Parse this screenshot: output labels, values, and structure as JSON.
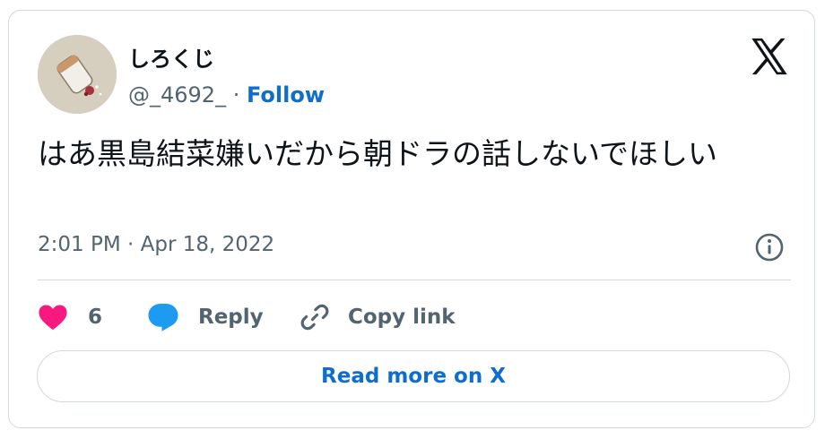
{
  "author": {
    "display_name": "しろくじ",
    "handle": "@_4692_",
    "separator": " · ",
    "follow_label": "Follow"
  },
  "tweet": {
    "text": "はあ黒島結菜嫌いだから朝ドラの話しないでほしい",
    "timestamp": "2:01 PM · Apr 18, 2022"
  },
  "actions": {
    "like_count": "6",
    "reply_label": "Reply",
    "copy_link_label": "Copy link"
  },
  "read_more_label": "Read more on X",
  "colors": {
    "like": "#f91880",
    "reply": "#1d9bf0",
    "link": "#0f6ecd",
    "muted": "#536471"
  },
  "icons": [
    "x-logo-icon",
    "info-icon",
    "heart-icon",
    "speech-bubble-icon",
    "link-icon"
  ]
}
